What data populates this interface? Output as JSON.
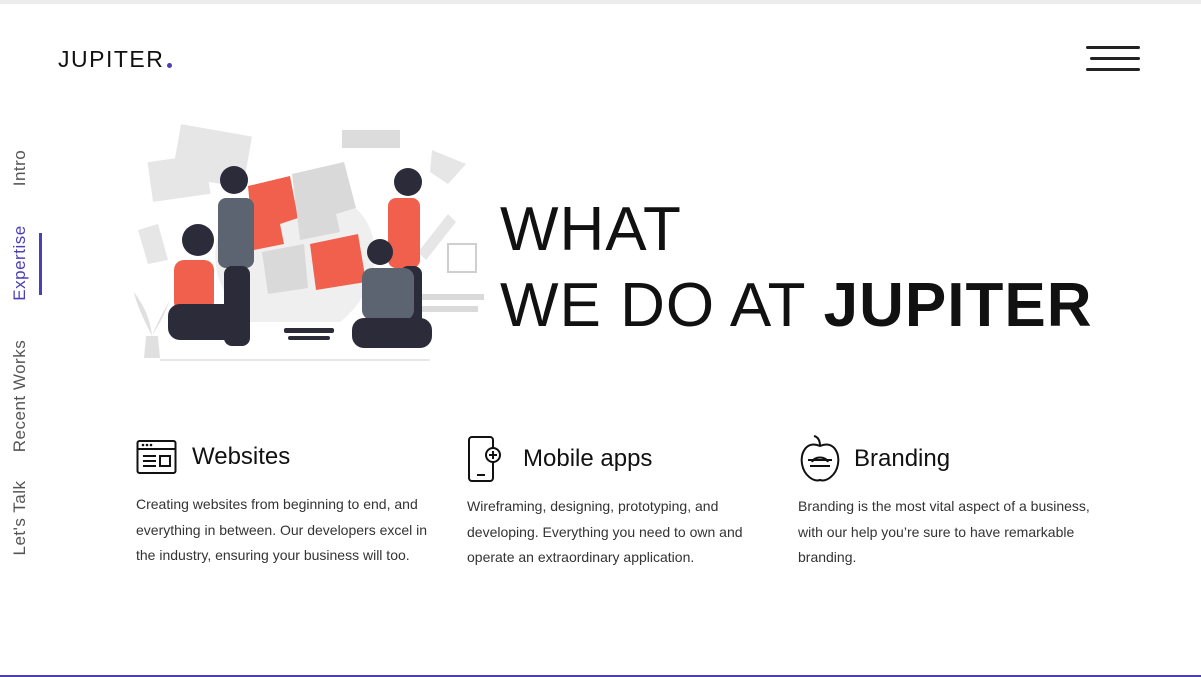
{
  "brand": {
    "name": "JUPITER",
    "accent_color": "#4a3fb5"
  },
  "header": {
    "menu_icon": "hamburger-menu-icon"
  },
  "side_nav": {
    "items": [
      {
        "label": "Intro",
        "active": false
      },
      {
        "label": "Expertise",
        "active": true
      },
      {
        "label": "Recent Works",
        "active": false
      },
      {
        "label": "Let's Talk",
        "active": false
      }
    ]
  },
  "hero": {
    "line1": "WHAT",
    "line2_prefix": "WE DO AT",
    "line2_strong": "JUPITER",
    "illustration": "team-assembling-puzzle-lightbulb-illustration",
    "illustration_colors": {
      "primary": "#f0604d",
      "neutral": "#d9d9d9",
      "dark": "#2b2b3a"
    }
  },
  "services": [
    {
      "icon": "browser-window-icon",
      "title": "Websites",
      "description": "Creating websites from beginning to end, and everything in between. Our developers excel in the industry, ensuring your business will too."
    },
    {
      "icon": "mobile-phone-icon",
      "title": "Mobile apps",
      "description": "Wireframing, designing, prototyping, and developing. Everything you need to own and operate an extraordinary application."
    },
    {
      "icon": "apple-brand-icon",
      "title": "Branding",
      "description": "Branding is the most vital aspect of a business, with our help you’re sure to have remarkable branding."
    }
  ]
}
